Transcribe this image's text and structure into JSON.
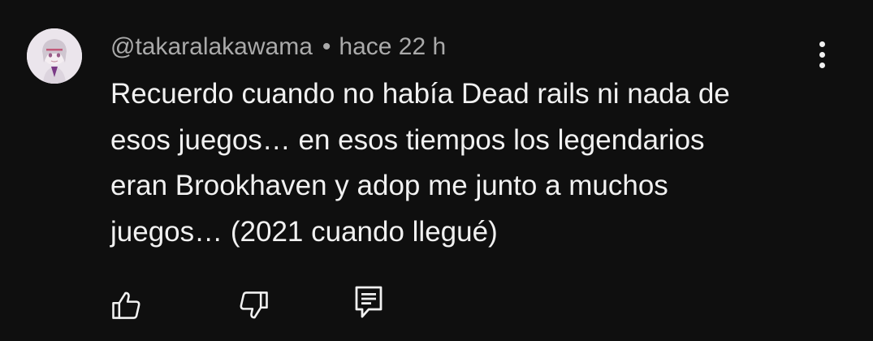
{
  "comment": {
    "author": "@takaralakawama",
    "separator": "•",
    "time": "hace 22 h",
    "text_lines": [
      "Recuerdo cuando no había Dead rails ni nada de",
      "esos juegos… en esos tiempos los legendarios",
      "eran Brookhaven y adop me junto a muchos",
      "juegos… (2021 cuando llegué)"
    ]
  },
  "icons": {
    "avatar": "avatar-image",
    "menu": "more-vertical-icon",
    "like": "thumb-up-icon",
    "dislike": "thumb-down-icon",
    "reply": "comment-icon"
  },
  "colors": {
    "background": "#0f0f0f",
    "text_primary": "#f1f1f1",
    "text_secondary": "#aaaaaa"
  }
}
